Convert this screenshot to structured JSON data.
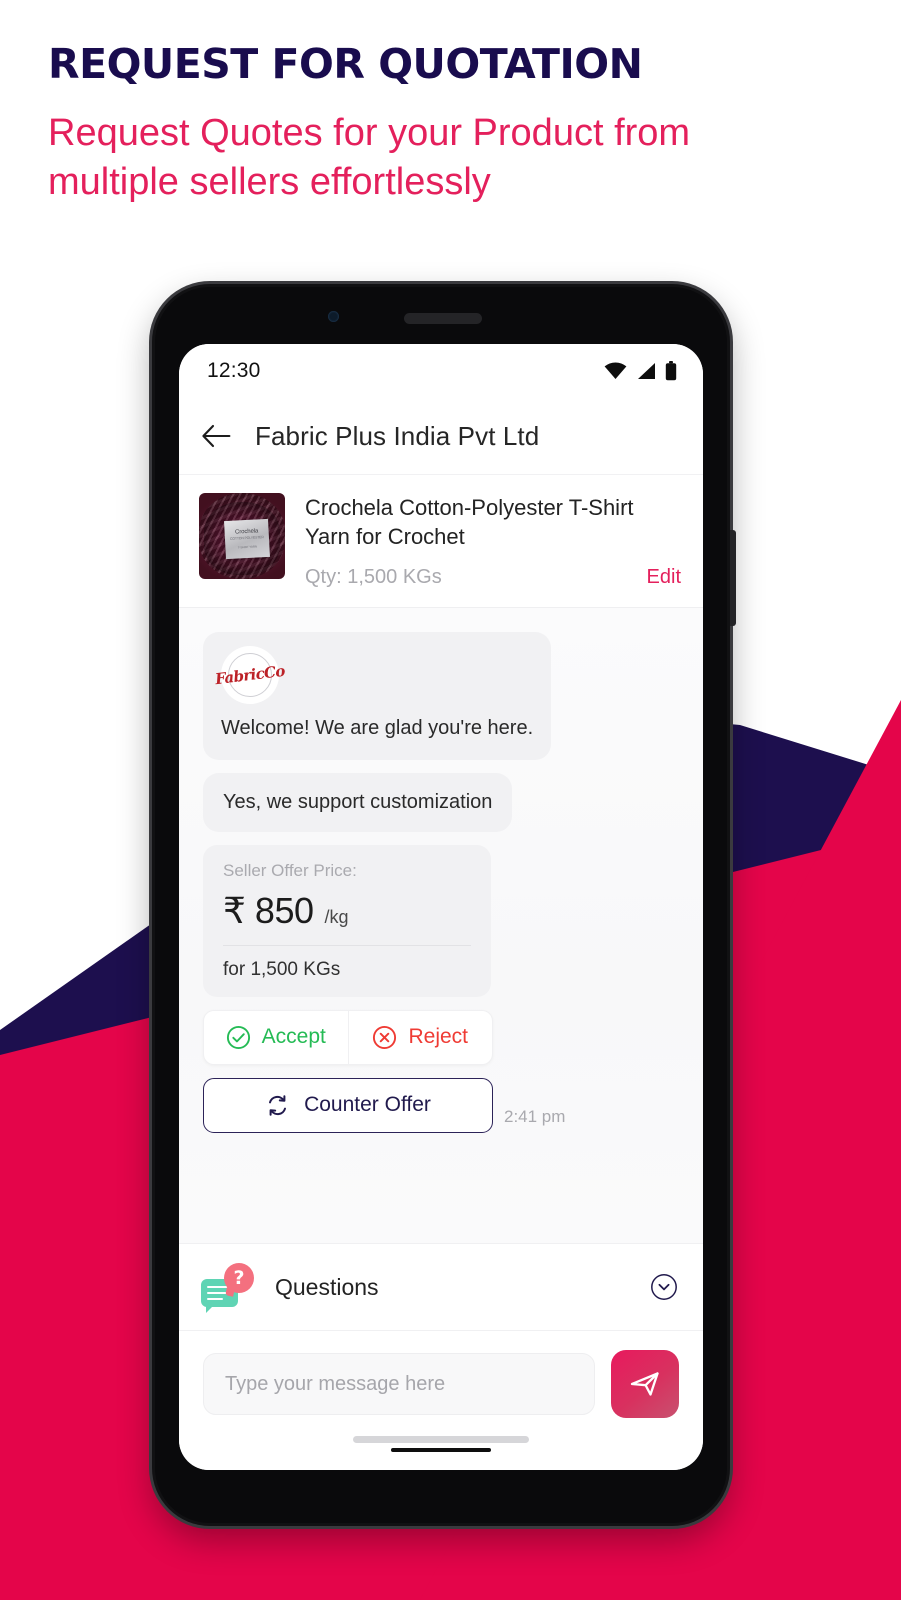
{
  "promo": {
    "title": "REQUEST FOR QUOTATION",
    "subtitle": "Request Quotes for your Product from multiple sellers effortlessly"
  },
  "colors": {
    "navy": "#1d0f4e",
    "crimson": "#e4054a",
    "accent_pink": "#e4205c",
    "accept_green": "#25bb55",
    "reject_red": "#ef3b34",
    "bubble_gray": "#f1f1f3",
    "mint": "#5fd4b4",
    "salmon": "#f4707f"
  },
  "phone": {
    "statusbar": {
      "time": "12:30",
      "icons": [
        "wifi-icon",
        "cellular-signal-icon",
        "battery-icon"
      ]
    },
    "appbar": {
      "back_icon": "back-arrow-icon",
      "title": "Fabric Plus India Pvt Ltd"
    },
    "product": {
      "thumbnail_label": "Crochela",
      "thumbnail_sub": "COTTON POLYESTER",
      "thumbnail_sub2": "T-SHIRT YARN",
      "name": "Crochela Cotton-Polyester T-Shirt Yarn for Crochet",
      "qty": "Qty: 1,500 KGs",
      "edit_label": "Edit"
    },
    "chat": {
      "messages": [
        {
          "type": "bubble-with-avatar",
          "avatar_mark": "FabricCo",
          "text": "Welcome! We are glad you're here."
        },
        {
          "type": "bubble",
          "text": "Yes, we support customization"
        }
      ],
      "offer": {
        "label": "Seller Offer Price:",
        "currency": "₹",
        "price": "850",
        "unit": "/kg",
        "quantity_line": "for 1,500 KGs"
      },
      "actions": {
        "accept_label": "Accept",
        "accept_icon": "check-circle-icon",
        "reject_label": "Reject",
        "reject_icon": "x-circle-icon",
        "counter_label": "Counter Offer",
        "counter_icon": "swap-refresh-icon"
      },
      "timestamp": "2:41 pm"
    },
    "questions": {
      "label": "Questions",
      "icon": "question-chat-icon",
      "expand_icon": "chevron-down-circle-icon"
    },
    "composer": {
      "placeholder": "Type your message here",
      "value": "",
      "send_icon": "send-paper-plane-icon"
    }
  }
}
